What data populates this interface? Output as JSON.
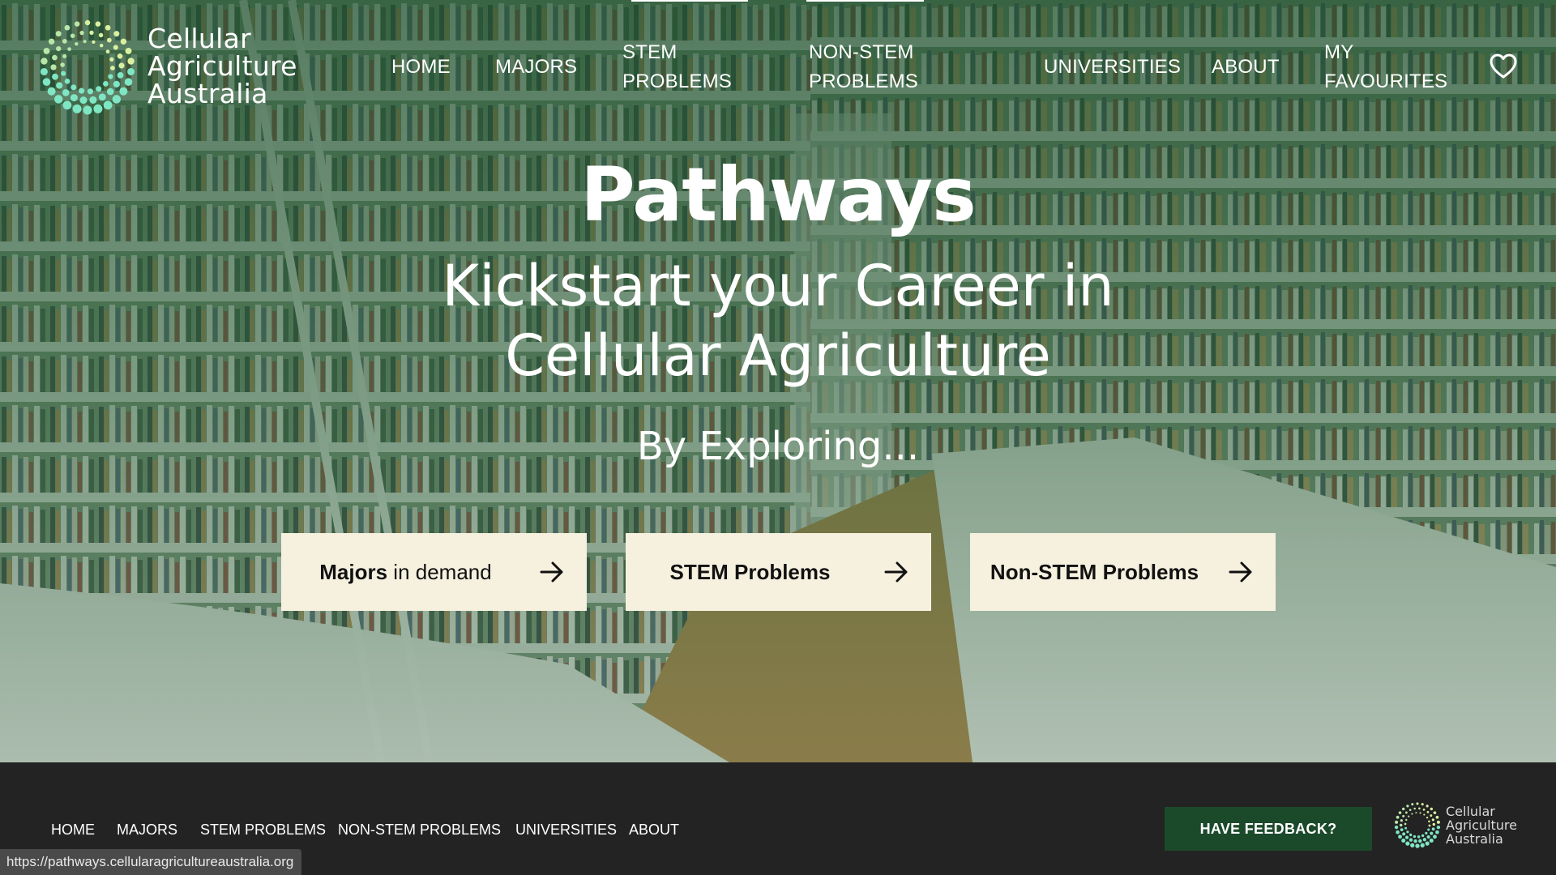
{
  "brand": {
    "logo_lines": [
      "Cellular",
      "Agriculture",
      "Australia"
    ],
    "logo_icon": "dotted-ring-logo",
    "colors": {
      "hero_green": "#2f5f3c",
      "cta_bg": "#f6f1df",
      "footer_bg": "#232323",
      "feedback_bg": "#1b4a2b"
    }
  },
  "nav": {
    "items": [
      {
        "label": "HOME"
      },
      {
        "label": "MAJORS"
      },
      {
        "label": "STEM PROBLEMS"
      },
      {
        "label": "NON-STEM PROBLEMS"
      },
      {
        "label": "UNIVERSITIES"
      },
      {
        "label": "ABOUT"
      },
      {
        "label": "MY FAVOURITES"
      }
    ],
    "favourites_icon": "heart-icon"
  },
  "hero": {
    "title": "Pathways",
    "subtitle_lines": [
      "Kickstart your Career in",
      "Cellular Agriculture"
    ],
    "explore": "By Exploring...",
    "ctas": [
      {
        "bold": "Majors",
        "rest": " in demand",
        "icon": "arrow-right-icon"
      },
      {
        "bold": "STEM Problems",
        "rest": "",
        "icon": "arrow-right-icon"
      },
      {
        "bold": "Non-STEM Problems",
        "rest": "",
        "icon": "arrow-right-icon"
      }
    ]
  },
  "footer": {
    "nav": [
      "HOME",
      "MAJORS",
      "STEM PROBLEMS",
      "NON-STEM PROBLEMS",
      "UNIVERSITIES",
      "ABOUT"
    ],
    "feedback_label": "HAVE FEEDBACK?",
    "logo_lines": [
      "Cellular",
      "Agriculture",
      "Australia"
    ]
  },
  "status_bar": {
    "url": "https://pathways.cellularagricultureaustralia.org"
  }
}
